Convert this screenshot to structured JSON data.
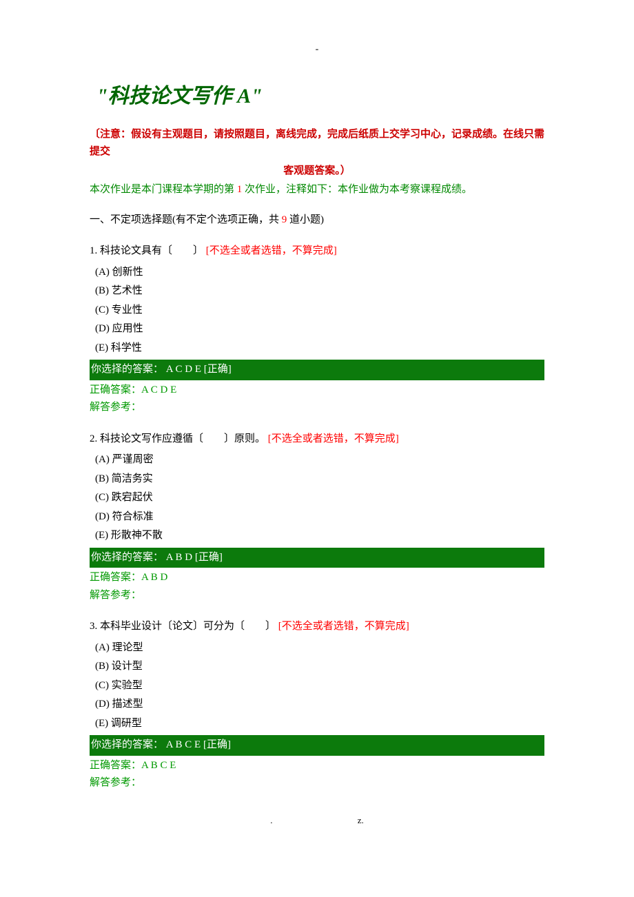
{
  "top_dash": "-",
  "title": "\"科技论文写作 A\"",
  "notice_line1": "〔注意：假设有主观题目，请按照题目，离线完成，完成后纸质上交学习中心，记录成绩。在线只需提交",
  "notice_line2": "客观题答案。）",
  "sub_notice_prefix": "本次作业是本门课程本学期的第 ",
  "sub_notice_num": "1",
  "sub_notice_suffix": " 次作业，注释如下：本作业做为本考察课程成绩。",
  "section_header_prefix": "一、不定项选择题(有不定个选项正确，共 ",
  "section_header_count": "9",
  "section_header_suffix": " 道小题)",
  "warn_text": "[不选全或者选错，不算完成]",
  "selected_label": "你选择的答案：",
  "correct_label_suffix": "[正确]",
  "correct_ans_label": "正确答案：",
  "ref_label": "解答参考：",
  "questions": [
    {
      "num": "1.",
      "stem": "科技论文具有〔　　〕",
      "options": [
        "(A) 创新性",
        "(B) 艺术性",
        "(C) 专业性",
        "(D) 应用性",
        "(E) 科学性"
      ],
      "selected": " A C D E ",
      "correct": "A C D E"
    },
    {
      "num": "2.",
      "stem": "科技论文写作应遵循〔　　〕原则。",
      "options": [
        "(A) 严谨周密",
        "(B) 简洁务实",
        "(C) 跌宕起伏",
        "(D) 符合标准",
        "(E) 形散神不散"
      ],
      "selected": " A B D ",
      "correct": "A B D"
    },
    {
      "num": "3.",
      "stem": "本科毕业设计〔论文〕可分为〔　　〕",
      "options": [
        "(A) 理论型",
        "(B) 设计型",
        "(C) 实验型",
        "(D) 描述型",
        "(E) 调研型"
      ],
      "selected": " A B C E ",
      "correct": "A B C E"
    }
  ],
  "footer_left": ".",
  "footer_right": "z."
}
